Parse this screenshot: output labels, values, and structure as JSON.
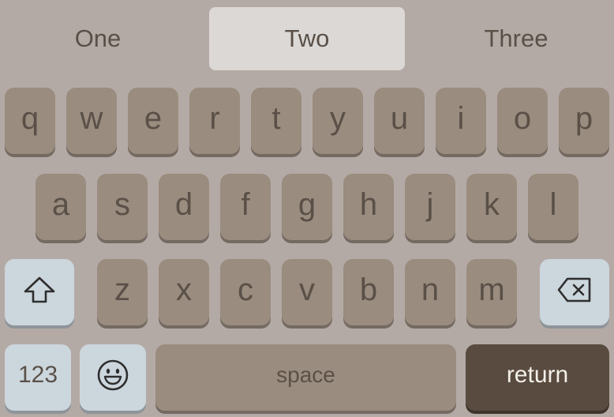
{
  "suggestions": [
    "One",
    "Two",
    "Three"
  ],
  "selected_suggestion": "Two",
  "rows": {
    "row1": [
      "q",
      "w",
      "e",
      "r",
      "t",
      "y",
      "u",
      "i",
      "o",
      "p"
    ],
    "row2": [
      "a",
      "s",
      "d",
      "f",
      "g",
      "h",
      "j",
      "k",
      "l"
    ],
    "row3": [
      "z",
      "x",
      "c",
      "v",
      "b",
      "n",
      "m"
    ]
  },
  "keys": {
    "shift_icon": "shift-arrow",
    "backspace_icon": "backspace",
    "numbers": "123",
    "emoji_icon": "smiley-face",
    "space": "space",
    "return": "return"
  },
  "colors": {
    "background": "#b4aaa5",
    "letter_key": "#9a8c7e",
    "special_key": "#ccd6dd",
    "return_key": "#594b3f",
    "selected_suggestion": "#dcd8d5"
  }
}
